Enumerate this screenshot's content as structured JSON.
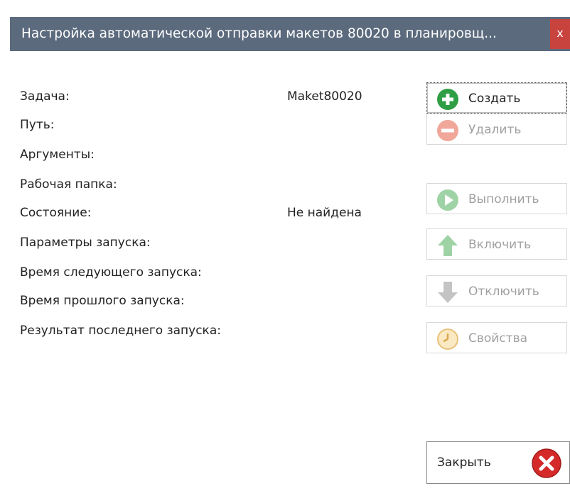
{
  "window": {
    "title": "Настройка автоматической отправки макетов 80020 в планировщ...",
    "close_glyph": "x"
  },
  "fields": [
    {
      "label": "Задача:",
      "value": "Maket80020"
    },
    {
      "label": "Путь:",
      "value": ""
    },
    {
      "label": "Аргументы:",
      "value": ""
    },
    {
      "label": "Рабочая папка:",
      "value": ""
    },
    {
      "label": "Состояние:",
      "value": "Не найдена"
    },
    {
      "label": "Параметры запуска:",
      "value": ""
    },
    {
      "label": "Время следующего запуска:",
      "value": ""
    },
    {
      "label": "Время прошлого запуска:",
      "value": ""
    },
    {
      "label": "Результат последнего запуска:",
      "value": ""
    }
  ],
  "buttons": {
    "create": {
      "label": "Создать",
      "icon": "plus-circle-icon",
      "enabled": true
    },
    "delete": {
      "label": "Удалить",
      "icon": "minus-circle-icon",
      "enabled": false
    },
    "run": {
      "label": "Выполнить",
      "icon": "play-circle-icon",
      "enabled": false
    },
    "enable": {
      "label": "Включить",
      "icon": "arrow-up-icon",
      "enabled": false
    },
    "disable": {
      "label": "Отключить",
      "icon": "arrow-down-icon",
      "enabled": false
    },
    "properties": {
      "label": "Свойства",
      "icon": "clock-icon",
      "enabled": false
    },
    "close": {
      "label": "Закрыть",
      "icon": "close-circle-icon",
      "enabled": true
    }
  },
  "colors": {
    "titlebar": "#5b6a7d",
    "close_x": "#c9433e",
    "create_icon": "#2f9e44",
    "close_icon": "#d42a2a"
  }
}
